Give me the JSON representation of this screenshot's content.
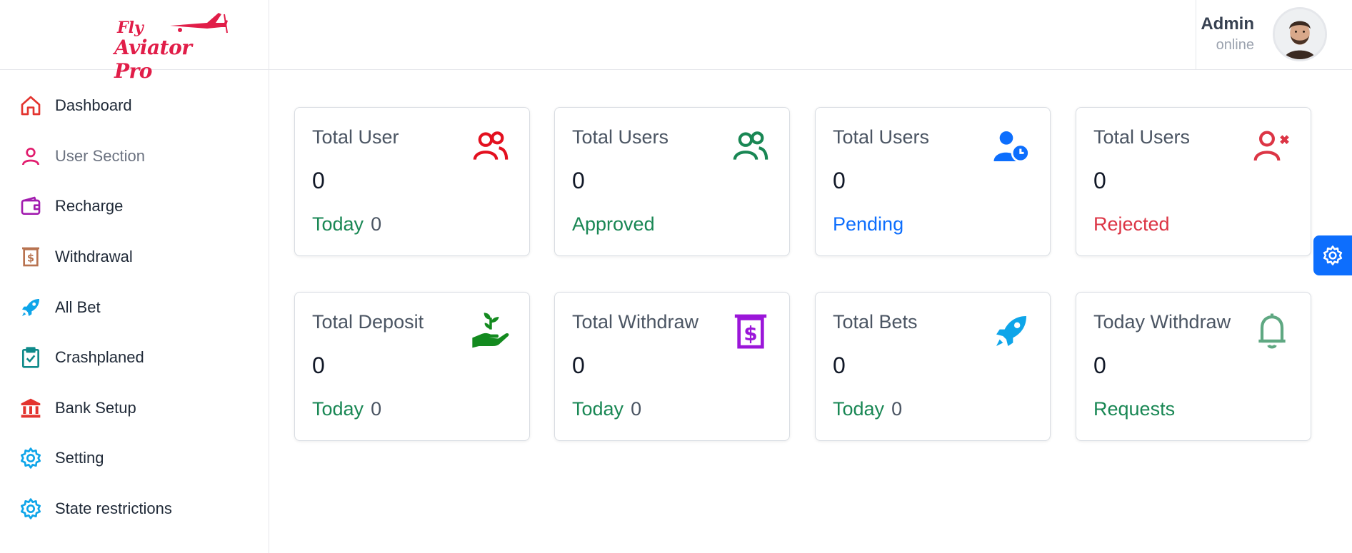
{
  "brand": {
    "line1": "Fly",
    "line2": "Aviator Pro"
  },
  "header": {
    "user_name": "Admin",
    "user_status": "online"
  },
  "sidebar": {
    "items": [
      {
        "label": "Dashboard",
        "icon": "home-icon"
      },
      {
        "label": "User Section",
        "icon": "user-icon"
      },
      {
        "label": "Recharge",
        "icon": "wallet-icon"
      },
      {
        "label": "Withdrawal",
        "icon": "dollar-receipt-icon"
      },
      {
        "label": "All Bet",
        "icon": "rocket-icon"
      },
      {
        "label": "Crashplaned",
        "icon": "clipboard-check-icon"
      },
      {
        "label": "Bank Setup",
        "icon": "bank-icon"
      },
      {
        "label": "Setting",
        "icon": "gear-icon"
      },
      {
        "label": "State restrictions",
        "icon": "gear-icon"
      }
    ]
  },
  "cards": [
    {
      "title": "Total User",
      "value": "0",
      "footer_label": "Today",
      "footer_count": "0",
      "icon": "users-outline-icon",
      "icon_color": "#e3101f",
      "footer_color": "#198754"
    },
    {
      "title": "Total Users",
      "value": "0",
      "footer_label": "Approved",
      "footer_count": "",
      "icon": "users-outline-icon",
      "icon_color": "#198754",
      "footer_color": "#198754"
    },
    {
      "title": "Total Users",
      "value": "0",
      "footer_label": "Pending",
      "footer_count": "",
      "icon": "user-clock-icon",
      "icon_color": "#0d6efd",
      "footer_color": "#0d6efd"
    },
    {
      "title": "Total Users",
      "value": "0",
      "footer_label": "Rejected",
      "footer_count": "",
      "icon": "user-x-icon",
      "icon_color": "#dc3545",
      "footer_color": "#dc3545"
    },
    {
      "title": "Total Deposit",
      "value": "0",
      "footer_label": "Today",
      "footer_count": "0",
      "icon": "hand-plant-icon",
      "icon_color": "#138a1f",
      "footer_color": "#198754"
    },
    {
      "title": "Total Withdraw",
      "value": "0",
      "footer_label": "Today",
      "footer_count": "0",
      "icon": "dollar-receipt-icon",
      "icon_color": "#9b16d9",
      "footer_color": "#198754"
    },
    {
      "title": "Total Bets",
      "value": "0",
      "footer_label": "Today",
      "footer_count": "0",
      "icon": "rocket-icon",
      "icon_color": "#0ea5e9",
      "footer_color": "#198754"
    },
    {
      "title": "Today Withdraw",
      "value": "0",
      "footer_label": "Requests",
      "footer_count": "",
      "icon": "bell-icon",
      "icon_color": "#5fa882",
      "footer_color": "#198754"
    }
  ],
  "colors": {
    "brand": "#e11d48",
    "fab": "#0d6efd"
  }
}
